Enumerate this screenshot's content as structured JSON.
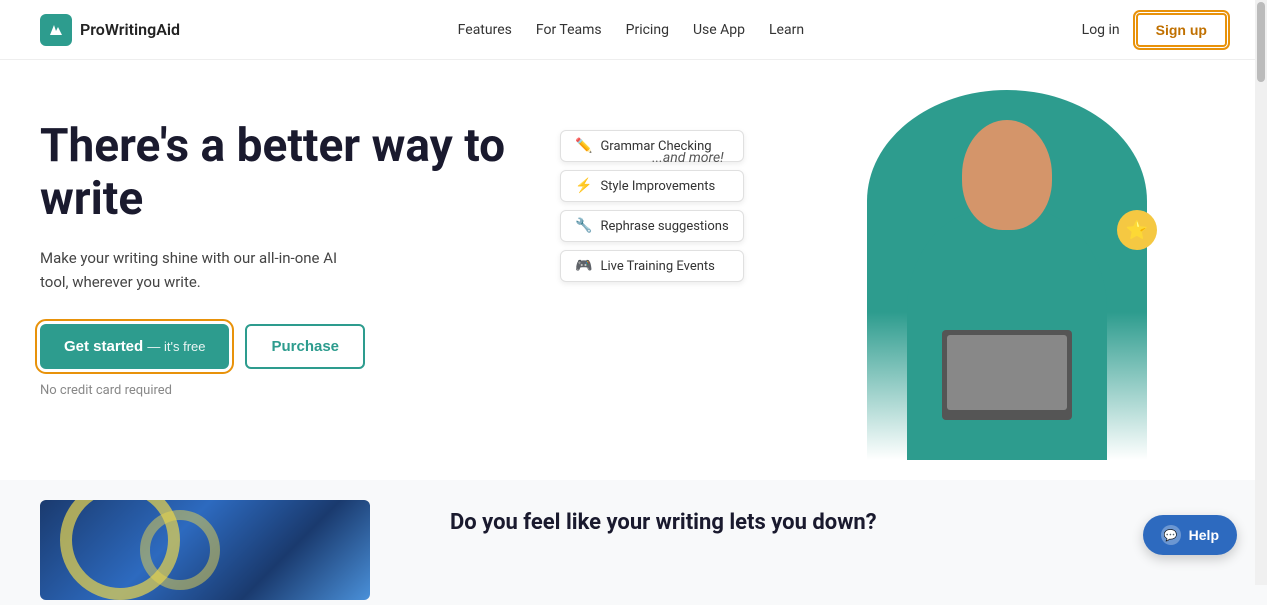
{
  "nav": {
    "logo_text": "ProWritingAid",
    "links": [
      {
        "label": "Features",
        "id": "features"
      },
      {
        "label": "For Teams",
        "id": "for-teams"
      },
      {
        "label": "Pricing",
        "id": "pricing"
      },
      {
        "label": "Use App",
        "id": "use-app"
      },
      {
        "label": "Learn",
        "id": "learn"
      }
    ],
    "login_label": "Log in",
    "signup_label": "Sign up"
  },
  "hero": {
    "title": "There's a better way to write",
    "subtitle": "Make your writing shine with our all-in-one AI tool, wherever you write.",
    "cta_label": "Get started",
    "cta_free": "— it's free",
    "purchase_label": "Purchase",
    "no_credit": "No credit card required",
    "and_more": "...and more!",
    "features": [
      {
        "icon": "✏️",
        "label": "Grammar Checking"
      },
      {
        "icon": "⚡",
        "label": "Style Improvements"
      },
      {
        "icon": "🔧",
        "label": "Rephrase suggestions"
      },
      {
        "icon": "🎮",
        "label": "Live Training Events"
      }
    ],
    "star_icon": "⭐"
  },
  "bottom": {
    "title": "Do you feel like your writing lets you down?"
  },
  "help": {
    "label": "Help"
  }
}
